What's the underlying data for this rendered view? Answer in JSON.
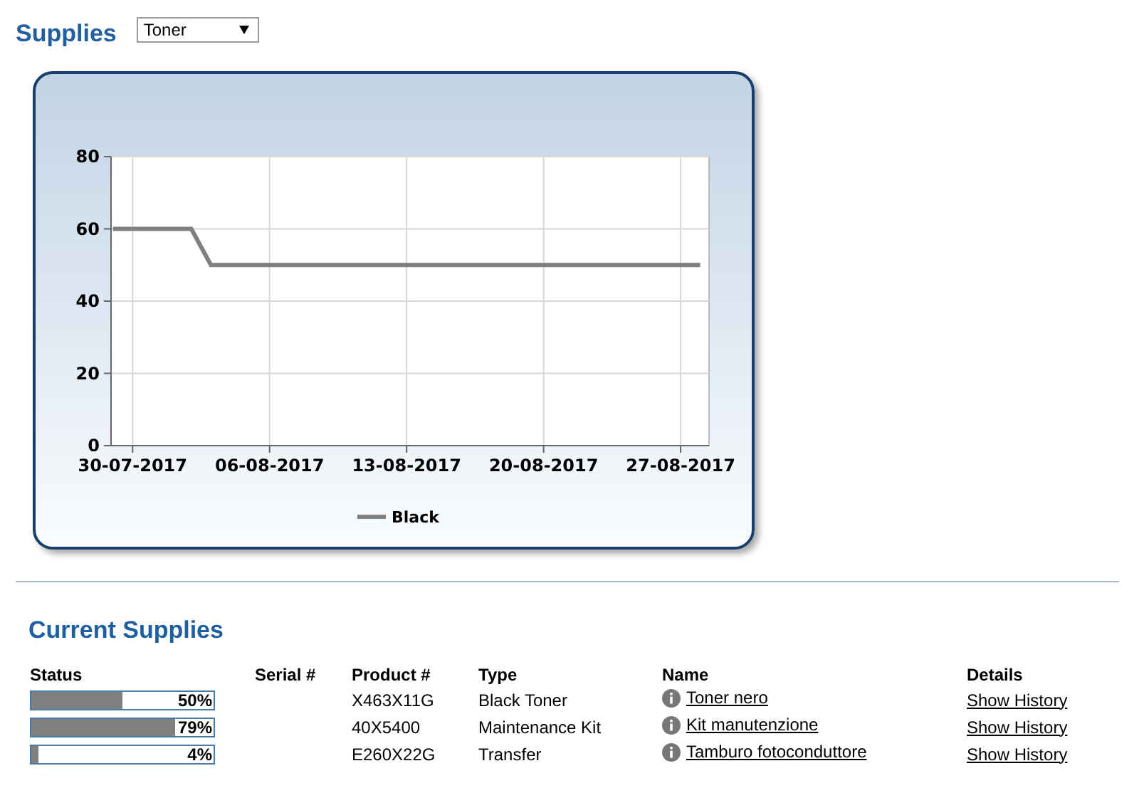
{
  "header": {
    "title": "Supplies",
    "dropdown": {
      "value": "Toner"
    }
  },
  "chart": {
    "chart_data": {
      "type": "line",
      "categories": [
        null,
        "30-07-2017",
        null,
        null,
        null,
        null,
        null,
        null,
        "06-08-2017",
        null,
        null,
        null,
        null,
        null,
        null,
        "13-08-2017",
        null,
        null,
        null,
        null,
        null,
        null,
        "20-08-2017",
        null,
        null,
        null,
        null,
        null,
        null,
        "27-08-2017",
        null
      ],
      "series": [
        {
          "name": "Black",
          "color": "#808080",
          "values": [
            60,
            60,
            60,
            60,
            60,
            50,
            50,
            50,
            50,
            50,
            50,
            50,
            50,
            50,
            50,
            50,
            50,
            50,
            50,
            50,
            50,
            50,
            50,
            50,
            50,
            50,
            50,
            50,
            50,
            50,
            50
          ]
        }
      ],
      "ylim": [
        0,
        80
      ],
      "grid": true,
      "yticks": [
        0,
        20,
        40,
        60,
        80
      ]
    }
  },
  "current_supplies": {
    "title": "Current Supplies",
    "columns": [
      "Status",
      "Serial #",
      "Product #",
      "Type",
      "Name",
      "Details"
    ],
    "rows": [
      {
        "level": 0.5,
        "percent": "50%",
        "product": "X463X11G",
        "type": "Black Toner",
        "name": "Toner nero",
        "details": "Show History"
      },
      {
        "level": 0.79,
        "percent": "79%",
        "product": "40X5400",
        "type": "Maintenance Kit",
        "name": "Kit manutenzione",
        "details": "Show History"
      },
      {
        "level": 0.04,
        "percent": "4%",
        "product": "E260X22G",
        "type": "Transfer",
        "name": "Tamburo fotoconduttore",
        "details": "Show History"
      }
    ]
  }
}
